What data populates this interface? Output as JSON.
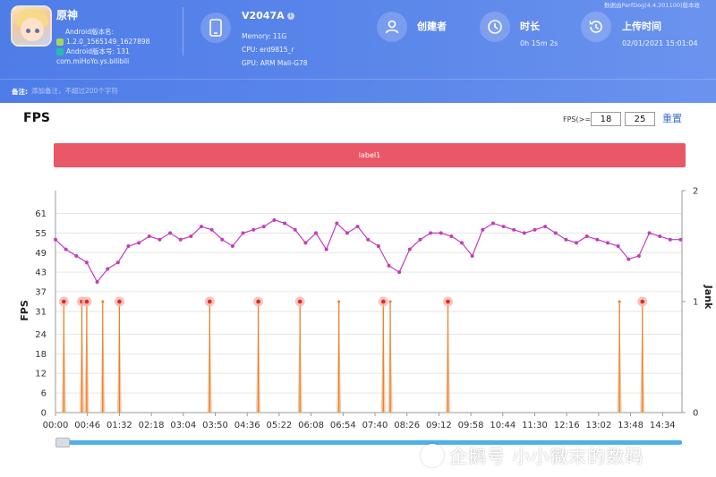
{
  "app": {
    "name": "原神",
    "version_label": "Android版本名:",
    "version_name": "1.2.0_1565149_1627898",
    "version_code": "Android版本号: 131",
    "package": "com.miHoYo.ys.bilibili"
  },
  "device": {
    "name": "V2047A",
    "memory": "Memory: 11G",
    "cpu": "CPU: erd9815_r",
    "gpu": "GPU: ARM Mali-G78"
  },
  "stats": {
    "creator_label": "创建者",
    "duration_label": "时长",
    "duration_value": "0h 15m 2s",
    "upload_label": "上传时间",
    "upload_value": "02/01/2021 15:01:04"
  },
  "top_note": "数据由PerfDog(4.4.201100)版本收",
  "remark": {
    "label": "备注:",
    "placeholder": "添加备注，不超过200个字符"
  },
  "fps_panel": {
    "title": "FPS",
    "threshold_label": "FPS(>=)",
    "threshold_low": "18",
    "threshold_high": "25",
    "reset_label": "重置",
    "label_bar": "label1"
  },
  "watermark": "企鹅号 小小微末的数码",
  "colors": {
    "header": "#5a86ea",
    "fps_line": "#c23dbb",
    "jank": "#e8812a",
    "label_bar": "#ea5867",
    "scroll": "#4fb0e8"
  },
  "chart_data": {
    "type": "line",
    "ylabel": "FPS",
    "y2label": "Jank",
    "ylim": [
      0,
      68
    ],
    "yticks": [
      0,
      6,
      12,
      18,
      24,
      31,
      37,
      43,
      49,
      55,
      61
    ],
    "y2lim": [
      0,
      2
    ],
    "y2ticks": [
      0,
      1,
      2
    ],
    "xlim_seconds": [
      0,
      902
    ],
    "xticks": [
      "00:00",
      "00:46",
      "01:32",
      "02:18",
      "03:04",
      "03:50",
      "04:36",
      "05:22",
      "06:08",
      "06:54",
      "07:40",
      "08:26",
      "09:12",
      "09:58",
      "10:44",
      "11:30",
      "12:16",
      "13:02",
      "13:48",
      "14:34"
    ],
    "series": [
      {
        "name": "FPS",
        "x": [
          0,
          15,
          30,
          45,
          60,
          75,
          90,
          105,
          120,
          135,
          150,
          165,
          180,
          195,
          210,
          225,
          240,
          255,
          270,
          285,
          300,
          315,
          330,
          345,
          360,
          375,
          390,
          405,
          420,
          435,
          450,
          465,
          480,
          495,
          510,
          525,
          540,
          555,
          570,
          585,
          600,
          615,
          630,
          645,
          660,
          675,
          690,
          705,
          720,
          735,
          750,
          765,
          780,
          795,
          810,
          825,
          840,
          855,
          870,
          885,
          900
        ],
        "values": [
          53,
          50,
          48,
          46,
          40,
          44,
          46,
          51,
          52,
          54,
          53,
          55,
          53,
          54,
          57,
          56,
          53,
          51,
          55,
          56,
          57,
          59,
          58,
          56,
          52,
          55,
          50,
          58,
          55,
          57,
          53,
          51,
          45,
          43,
          50,
          53,
          55,
          55,
          54,
          52,
          48,
          56,
          58,
          57,
          56,
          55,
          56,
          57,
          55,
          53,
          52,
          54,
          53,
          52,
          51,
          47,
          48,
          55,
          54,
          53,
          53
        ]
      },
      {
        "name": "Jank",
        "axis": "right",
        "x": [
          12,
          38,
          45,
          68,
          92,
          222,
          292,
          352,
          408,
          472,
          482,
          565,
          812,
          845
        ],
        "values": [
          1,
          1,
          1,
          1,
          1,
          1,
          1,
          1,
          1,
          1,
          1,
          1,
          1,
          1
        ],
        "marked": [
          true,
          true,
          true,
          false,
          true,
          true,
          true,
          true,
          false,
          true,
          false,
          true,
          false,
          true
        ]
      }
    ]
  }
}
